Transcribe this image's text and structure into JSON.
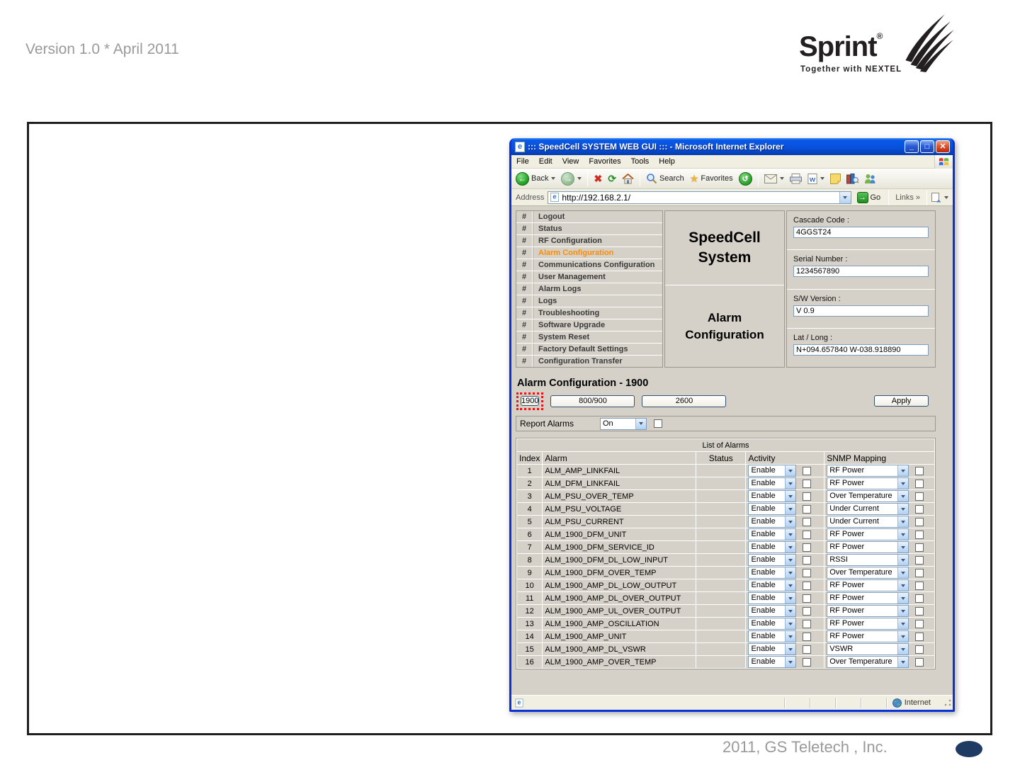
{
  "slide": {
    "version_text": "Version 1.0 * April 2011",
    "footer_text": "2011, GS Teletech , Inc.",
    "logo": {
      "brand": "Sprint",
      "registered_mark": "®",
      "tagline": "Together with NEXTEL"
    },
    "colors": {
      "footer_dot_navy": "#1f3a63",
      "frame_black": "#1f1f1f"
    }
  },
  "browser": {
    "window_title": "::: SpeedCell SYSTEM WEB GUI ::: - Microsoft Internet Explorer",
    "menu_items": [
      "File",
      "Edit",
      "View",
      "Favorites",
      "Tools",
      "Help"
    ],
    "toolbar": {
      "back_label": "Back",
      "search_label": "Search",
      "favorites_label": "Favorites"
    },
    "address": {
      "label": "Address",
      "url": "http://192.168.2.1/",
      "go_label": "Go",
      "links_label": "Links",
      "links_chevron": "»"
    },
    "status_text": "Internet"
  },
  "page": {
    "nav_bullet": "#",
    "nav_items": [
      "Logout",
      "Status",
      "RF Configuration",
      "Alarm Configuration",
      "Communications Configuration",
      "User Management",
      "Alarm Logs",
      "Logs",
      "Troubleshooting",
      "Software Upgrade",
      "System Reset",
      "Factory Default Settings",
      "Configuration Transfer"
    ],
    "active_nav": "Alarm Configuration",
    "system_title": "SpeedCell\nSystem",
    "page_title": "Alarm\nConfiguration",
    "info_fields": [
      {
        "label": "Cascade Code :",
        "value": "4GGST24"
      },
      {
        "label": "Serial Number :",
        "value": "1234567890"
      },
      {
        "label": "S/W Version :",
        "value": "V 0.9"
      },
      {
        "label": "Lat / Long :",
        "value": "N+094.657840 W-038.918890"
      }
    ],
    "section_title": "Alarm Configuration - 1900",
    "band_buttons": [
      "1900",
      "800/900",
      "2600"
    ],
    "highlighted_band": "1900",
    "apply_label": "Apply",
    "report_alarms": {
      "label": "Report Alarms",
      "value": "On"
    },
    "table": {
      "caption": "List of Alarms",
      "columns": [
        "Index",
        "Alarm",
        "Status",
        "Activity",
        "SNMP Mapping"
      ],
      "rows": [
        {
          "index": "1",
          "alarm": "ALM_AMP_LINKFAIL",
          "status": "green",
          "activity": "Enable",
          "snmp": "RF Power"
        },
        {
          "index": "2",
          "alarm": "ALM_DFM_LINKFAIL",
          "status": "green",
          "activity": "Enable",
          "snmp": "RF Power"
        },
        {
          "index": "3",
          "alarm": "ALM_PSU_OVER_TEMP",
          "status": "green",
          "activity": "Enable",
          "snmp": "Over Temperature"
        },
        {
          "index": "4",
          "alarm": "ALM_PSU_VOLTAGE",
          "status": "green",
          "activity": "Enable",
          "snmp": "Under Current"
        },
        {
          "index": "5",
          "alarm": "ALM_PSU_CURRENT",
          "status": "green",
          "activity": "Enable",
          "snmp": "Under Current"
        },
        {
          "index": "6",
          "alarm": "ALM_1900_DFM_UNIT",
          "status": "green",
          "activity": "Enable",
          "snmp": "RF Power"
        },
        {
          "index": "7",
          "alarm": "ALM_1900_DFM_SERVICE_ID",
          "status": "green",
          "activity": "Enable",
          "snmp": "RF Power"
        },
        {
          "index": "8",
          "alarm": "ALM_1900_DFM_DL_LOW_INPUT",
          "status": "green",
          "activity": "Enable",
          "snmp": "RSSI"
        },
        {
          "index": "9",
          "alarm": "ALM_1900_DFM_OVER_TEMP",
          "status": "green",
          "activity": "Enable",
          "snmp": "Over Temperature"
        },
        {
          "index": "10",
          "alarm": "ALM_1900_AMP_DL_LOW_OUTPUT",
          "status": "green",
          "activity": "Enable",
          "snmp": "RF Power"
        },
        {
          "index": "11",
          "alarm": "ALM_1900_AMP_DL_OVER_OUTPUT",
          "status": "green",
          "activity": "Enable",
          "snmp": "RF Power"
        },
        {
          "index": "12",
          "alarm": "ALM_1900_AMP_UL_OVER_OUTPUT",
          "status": "green",
          "activity": "Enable",
          "snmp": "RF Power"
        },
        {
          "index": "13",
          "alarm": "ALM_1900_AMP_OSCILLATION",
          "status": "green",
          "activity": "Enable",
          "snmp": "RF Power"
        },
        {
          "index": "14",
          "alarm": "ALM_1900_AMP_UNIT",
          "status": "green",
          "activity": "Enable",
          "snmp": "RF Power"
        },
        {
          "index": "15",
          "alarm": "ALM_1900_AMP_DL_VSWR",
          "status": "green",
          "activity": "Enable",
          "snmp": "VSWR"
        },
        {
          "index": "16",
          "alarm": "ALM_1900_AMP_OVER_TEMP",
          "status": "green",
          "activity": "Enable",
          "snmp": "Over Temperature"
        }
      ]
    },
    "colors": {
      "status_green": "#00e400",
      "active_nav_orange": "#ff8c00",
      "highlight_red": "#ee1111"
    }
  }
}
